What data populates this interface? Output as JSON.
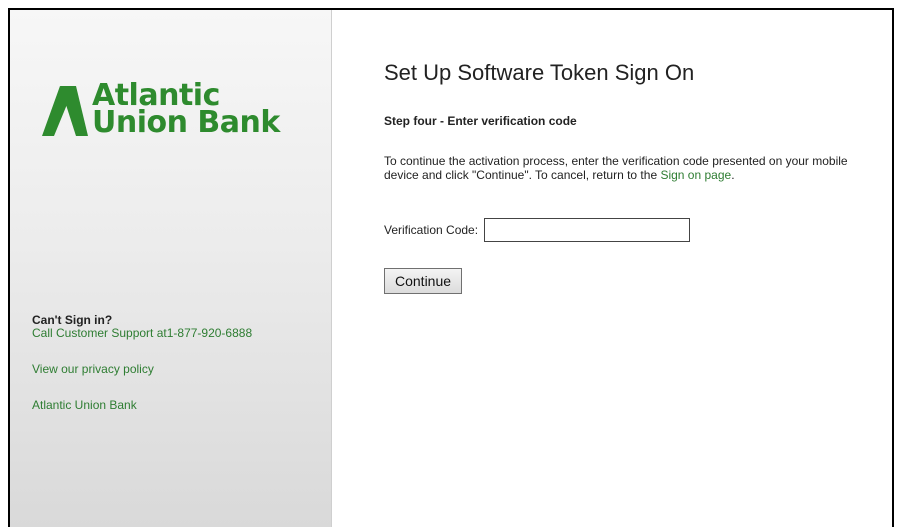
{
  "brand": {
    "line1": "Atlantic",
    "line2": "Union Bank",
    "color": "#2e8b2e"
  },
  "sidebar": {
    "cant_sign_in": "Can't Sign in?",
    "support_text": "Call Customer Support at1-877-920-6888",
    "privacy_link": "View our privacy policy",
    "bank_link": "Atlantic Union Bank"
  },
  "main": {
    "title": "Set Up Software Token Sign On",
    "step": "Step four - Enter verification code",
    "instructions_before": "To continue the activation process, enter the verification code presented on your mobile device and click \"Continue\". To cancel, return to the ",
    "instructions_link": "Sign on page",
    "instructions_after": ".",
    "verification_label": "Verification Code:",
    "verification_value": "",
    "continue_label": "Continue"
  }
}
